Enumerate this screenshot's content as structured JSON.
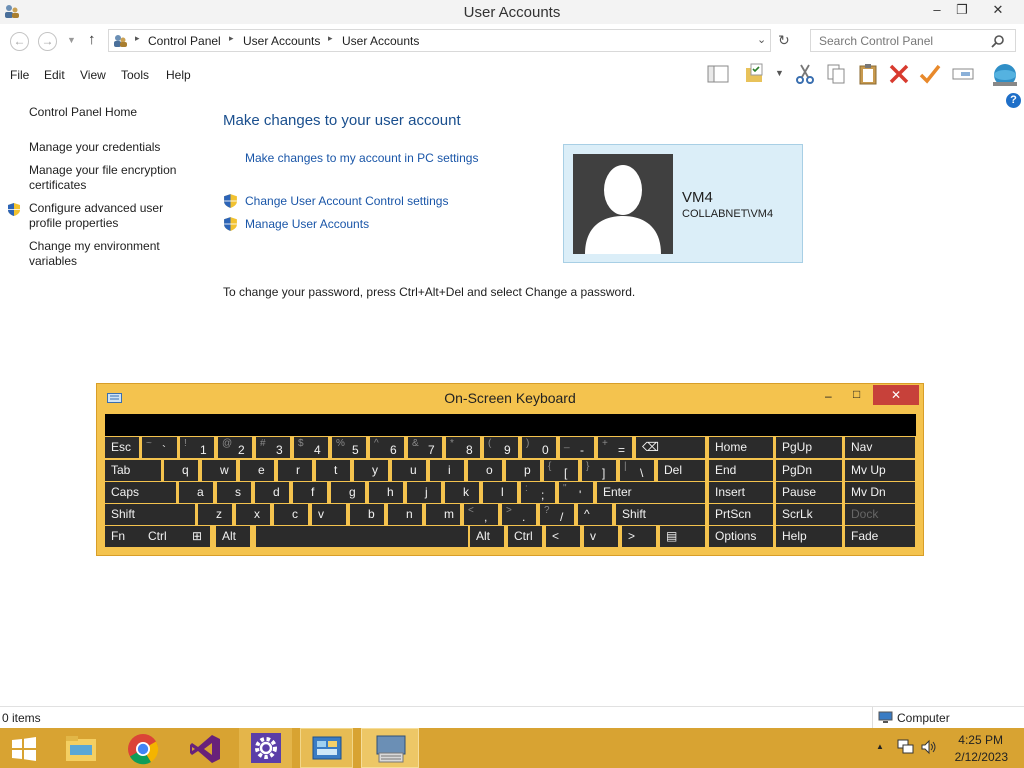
{
  "window": {
    "title": "User Accounts"
  },
  "address": {
    "crumbs": [
      "Control Panel",
      "User Accounts",
      "User Accounts"
    ],
    "search_placeholder": "Search Control Panel"
  },
  "menu": [
    "File",
    "Edit",
    "View",
    "Tools",
    "Help"
  ],
  "sidebar": {
    "home": "Control Panel Home",
    "links": [
      {
        "label": "Manage your credentials"
      },
      {
        "label": "Manage your file encryption certificates"
      },
      {
        "label": "Configure advanced user profile properties",
        "shield": true
      },
      {
        "label": "Change my environment variables"
      }
    ]
  },
  "main": {
    "heading": "Make changes to your user account",
    "pc_settings_link": "Make changes to my account in PC settings",
    "uac_link": "Change User Account Control settings",
    "manage_link": "Manage User Accounts",
    "password_note": "To change your password, press Ctrl+Alt+Del and select Change a password."
  },
  "user": {
    "name": "VM4",
    "account": "COLLABNET\\VM4"
  },
  "status": {
    "items": "0 items",
    "location": "Computer"
  },
  "osk": {
    "title": "On-Screen Keyboard",
    "rows": [
      [
        [
          "Esc",
          ""
        ],
        [
          "`",
          "~"
        ],
        [
          "1",
          "!"
        ],
        [
          "2",
          "@"
        ],
        [
          "3",
          "#"
        ],
        [
          "4",
          "$"
        ],
        [
          "5",
          "%"
        ],
        [
          "6",
          "^"
        ],
        [
          "7",
          "&"
        ],
        [
          "8",
          "*"
        ],
        [
          "9",
          "("
        ],
        [
          "0",
          ")"
        ],
        [
          "-",
          "_"
        ],
        [
          "=",
          "+"
        ],
        [
          "⌫",
          ""
        ]
      ],
      [
        [
          "Tab",
          ""
        ],
        [
          "q",
          ""
        ],
        [
          "w",
          ""
        ],
        [
          "e",
          ""
        ],
        [
          "r",
          ""
        ],
        [
          "t",
          ""
        ],
        [
          "y",
          ""
        ],
        [
          "u",
          ""
        ],
        [
          "i",
          ""
        ],
        [
          "o",
          ""
        ],
        [
          "p",
          ""
        ],
        [
          "[",
          "{"
        ],
        [
          "]",
          "}"
        ],
        [
          "\\",
          "|"
        ],
        [
          "Del",
          ""
        ]
      ],
      [
        [
          "Caps",
          ""
        ],
        [
          "a",
          ""
        ],
        [
          "s",
          ""
        ],
        [
          "d",
          ""
        ],
        [
          "f",
          ""
        ],
        [
          "g",
          ""
        ],
        [
          "h",
          ""
        ],
        [
          "j",
          ""
        ],
        [
          "k",
          ""
        ],
        [
          "l",
          ""
        ],
        [
          ";",
          ":"
        ],
        [
          "'",
          "\""
        ],
        [
          "Enter",
          ""
        ]
      ],
      [
        [
          "Shift",
          ""
        ],
        [
          "z",
          ""
        ],
        [
          "x",
          ""
        ],
        [
          "c",
          ""
        ],
        [
          "v",
          ""
        ],
        [
          "b",
          ""
        ],
        [
          "n",
          ""
        ],
        [
          "m",
          ""
        ],
        [
          ",",
          "<"
        ],
        [
          ".",
          ">"
        ],
        [
          "/",
          "?"
        ],
        [
          "^",
          ""
        ],
        [
          "Shift",
          ""
        ]
      ],
      [
        [
          "Fn",
          ""
        ],
        [
          "Ctrl",
          ""
        ],
        [
          "⊞",
          ""
        ],
        [
          "Alt",
          ""
        ],
        [
          "",
          ""
        ],
        [
          "Alt",
          ""
        ],
        [
          "Ctrl",
          ""
        ],
        [
          "<",
          ""
        ],
        [
          "v",
          ""
        ],
        [
          ">",
          ""
        ],
        [
          "▤",
          ""
        ]
      ]
    ],
    "side": [
      [
        "Home",
        "PgUp",
        "Nav"
      ],
      [
        "End",
        "PgDn",
        "Mv Up"
      ],
      [
        "Insert",
        "Pause",
        "Mv Dn"
      ],
      [
        "PrtScn",
        "ScrLk",
        "Dock"
      ],
      [
        "Options",
        "Help",
        "Fade"
      ]
    ]
  },
  "clock": {
    "time": "4:25 PM",
    "date": "2/12/2023"
  }
}
